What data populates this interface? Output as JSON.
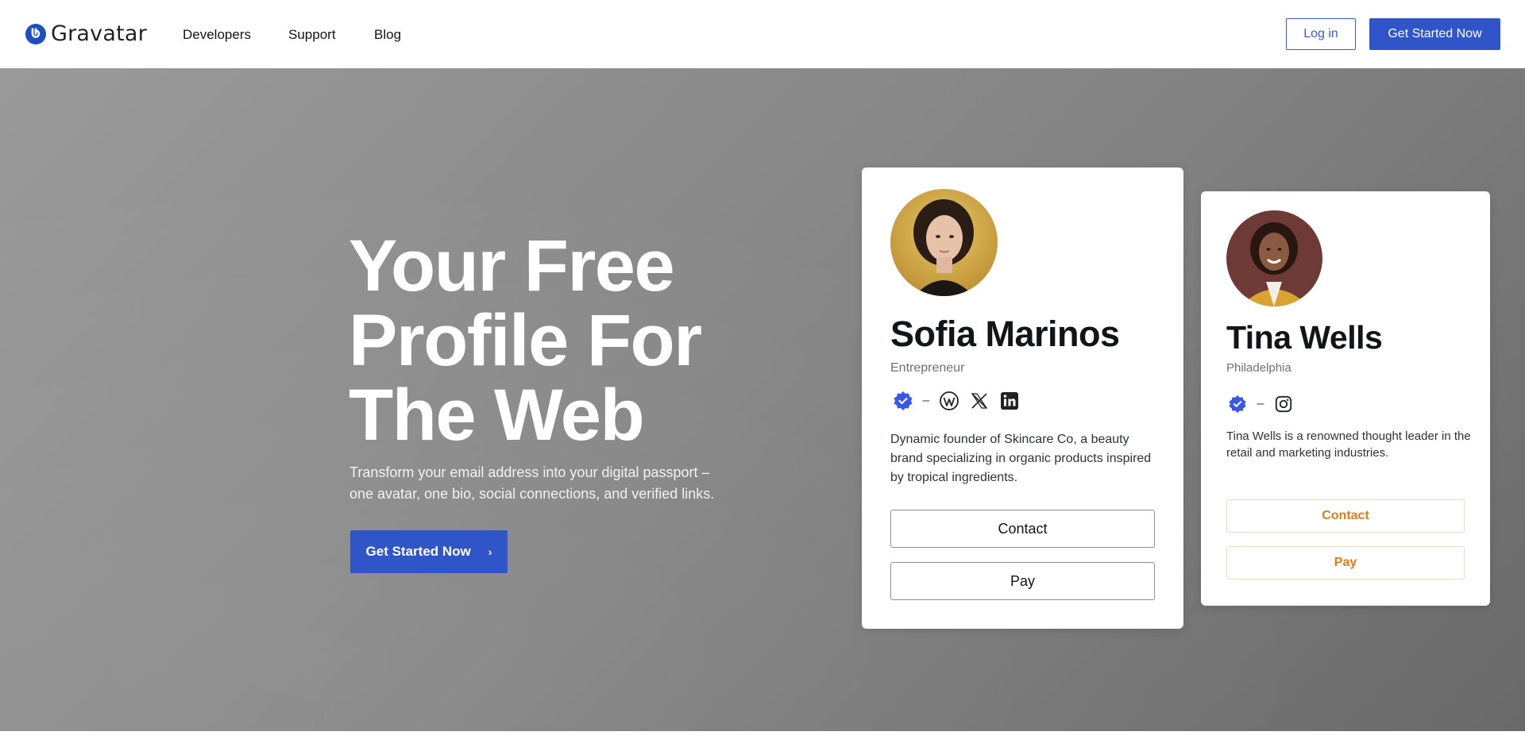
{
  "header": {
    "logo_text": "Gravatar",
    "nav": [
      {
        "label": "Developers"
      },
      {
        "label": "Support"
      },
      {
        "label": "Blog"
      }
    ],
    "login_label": "Log in",
    "get_started_label": "Get Started Now"
  },
  "hero": {
    "title_lines": [
      "Your Free",
      "Profile For",
      "The Web"
    ],
    "subtitle": "Transform your email address into your digital passport – one avatar, one bio, social connections, and verified links.",
    "cta_label": "Get Started Now",
    "cta_icon": "chevron-right-icon"
  },
  "cards": [
    {
      "name": "Sofia Marinos",
      "role": "Entrepreneur",
      "bio": "Dynamic founder of Skincare Co, a beauty brand specializing in organic products inspired by tropical ingredients.",
      "socials": [
        "verified-badge-icon",
        "wordpress-icon",
        "x-icon",
        "linkedin-icon"
      ],
      "contact_label": "Contact",
      "pay_label": "Pay"
    },
    {
      "name": "Tina Wells",
      "role": "Philadelphia",
      "bio": "Tina Wells is a renowned thought leader in the retail and marketing industries.",
      "socials": [
        "verified-badge-icon",
        "instagram-icon"
      ],
      "contact_label": "Contact",
      "pay_label": "Pay",
      "accent": "#d97c1a"
    }
  ],
  "colors": {
    "primary": "#2f55c8",
    "link_blue": "#3858e9",
    "badge_blue": "#3858e9",
    "hero_gray": "#858585"
  }
}
